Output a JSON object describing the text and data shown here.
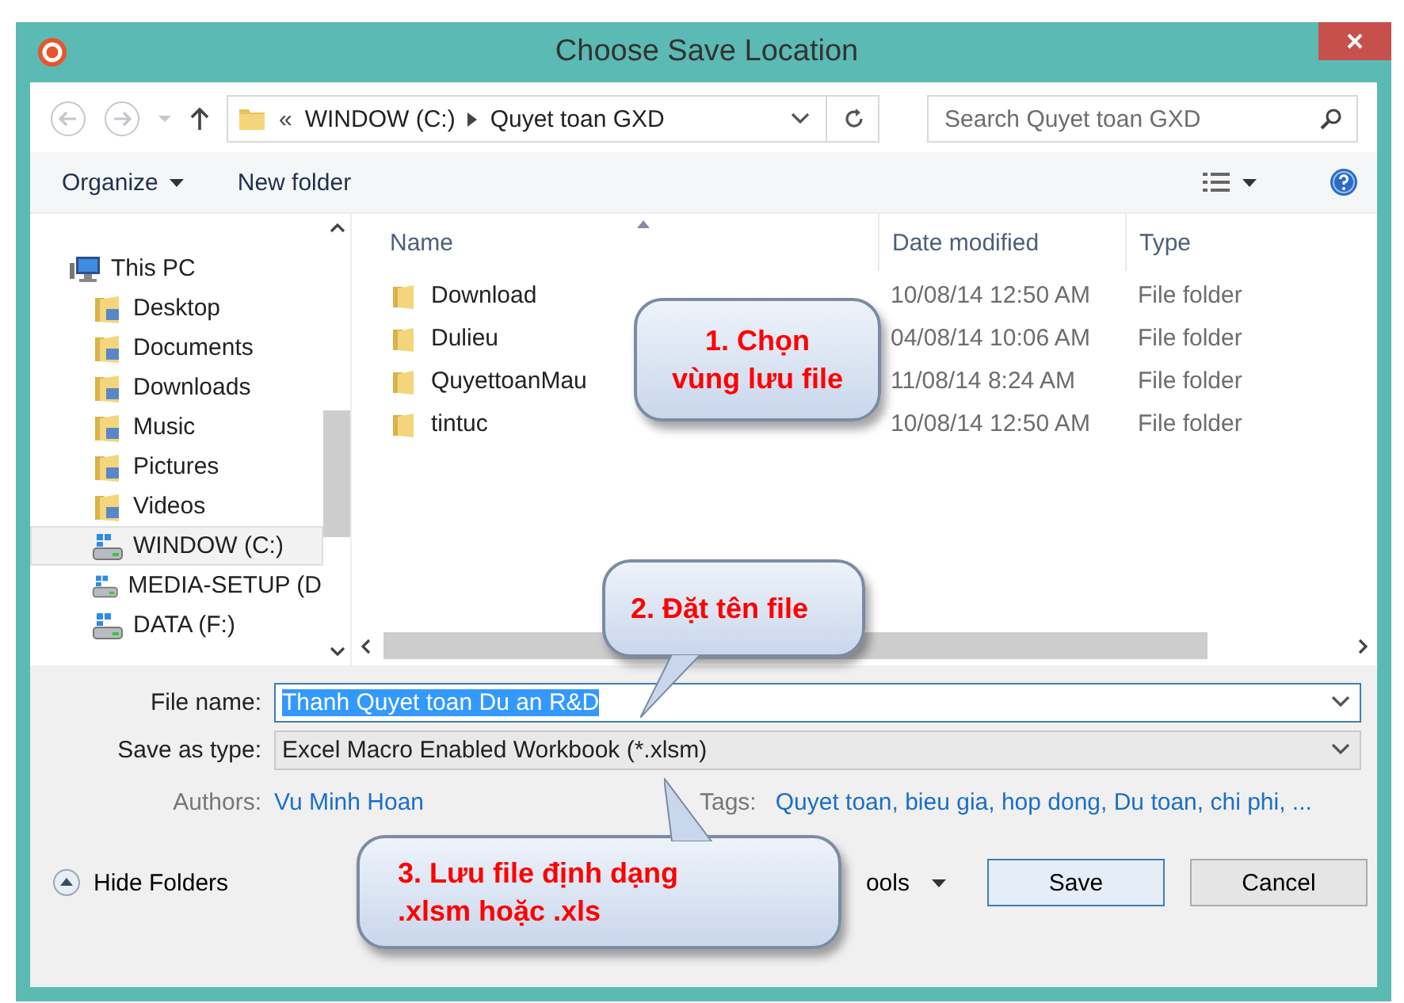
{
  "window": {
    "title": "Choose Save Location"
  },
  "address_bar": {
    "overflow": "«",
    "path": [
      "WINDOW (C:)",
      "Quyet toan GXD"
    ]
  },
  "search": {
    "placeholder": "Search Quyet toan GXD"
  },
  "toolbar": {
    "organize": "Organize",
    "new_folder": "New folder"
  },
  "nav_pane": {
    "items": [
      {
        "label": "This PC",
        "kind": "computer",
        "selected": false,
        "children": [
          {
            "label": "Desktop",
            "kind": "folder",
            "selected": false
          },
          {
            "label": "Documents",
            "kind": "folder",
            "selected": false
          },
          {
            "label": "Downloads",
            "kind": "folder",
            "selected": false
          },
          {
            "label": "Music",
            "kind": "folder",
            "selected": false
          },
          {
            "label": "Pictures",
            "kind": "folder",
            "selected": false
          },
          {
            "label": "Videos",
            "kind": "folder",
            "selected": false
          },
          {
            "label": "WINDOW (C:)",
            "kind": "drive",
            "selected": true
          },
          {
            "label": "MEDIA-SETUP (D",
            "kind": "drive",
            "selected": false
          },
          {
            "label": "DATA (F:)",
            "kind": "drive",
            "selected": false
          }
        ]
      }
    ]
  },
  "file_list": {
    "columns": [
      "Name",
      "Date modified",
      "Type"
    ],
    "rows": [
      {
        "name": "Download",
        "date": "10/08/14 12:50 AM",
        "type": "File folder"
      },
      {
        "name": "Dulieu",
        "date": "04/08/14 10:06 AM",
        "type": "File folder"
      },
      {
        "name": "QuyettoanMau",
        "date": "11/08/14 8:24 AM",
        "type": "File folder"
      },
      {
        "name": "tintuc",
        "date": "10/08/14 12:50 AM",
        "type": "File folder"
      }
    ]
  },
  "file_name": {
    "label": "File name:",
    "value": "Thanh Quyet toan Du an R&D"
  },
  "save_as_type": {
    "label": "Save as type:",
    "value": "Excel Macro Enabled Workbook (*.xlsm)"
  },
  "authors": {
    "label": "Authors:",
    "value": "Vu Minh Hoan"
  },
  "tags": {
    "label": "Tags:",
    "value": "Quyet toan, bieu gia, hop dong, Du toan, chi phi, ..."
  },
  "hide_folders": "Hide Folders",
  "tools": "ools",
  "buttons": [
    "Save",
    "Cancel"
  ],
  "callouts": [
    {
      "lines": [
        "1. Chọn",
        "vùng lưu file"
      ]
    },
    {
      "lines": [
        "2. Đặt tên file"
      ]
    },
    {
      "lines": [
        "3. Lưu file định dạng",
        ".xlsm hoặc .xls"
      ]
    }
  ]
}
